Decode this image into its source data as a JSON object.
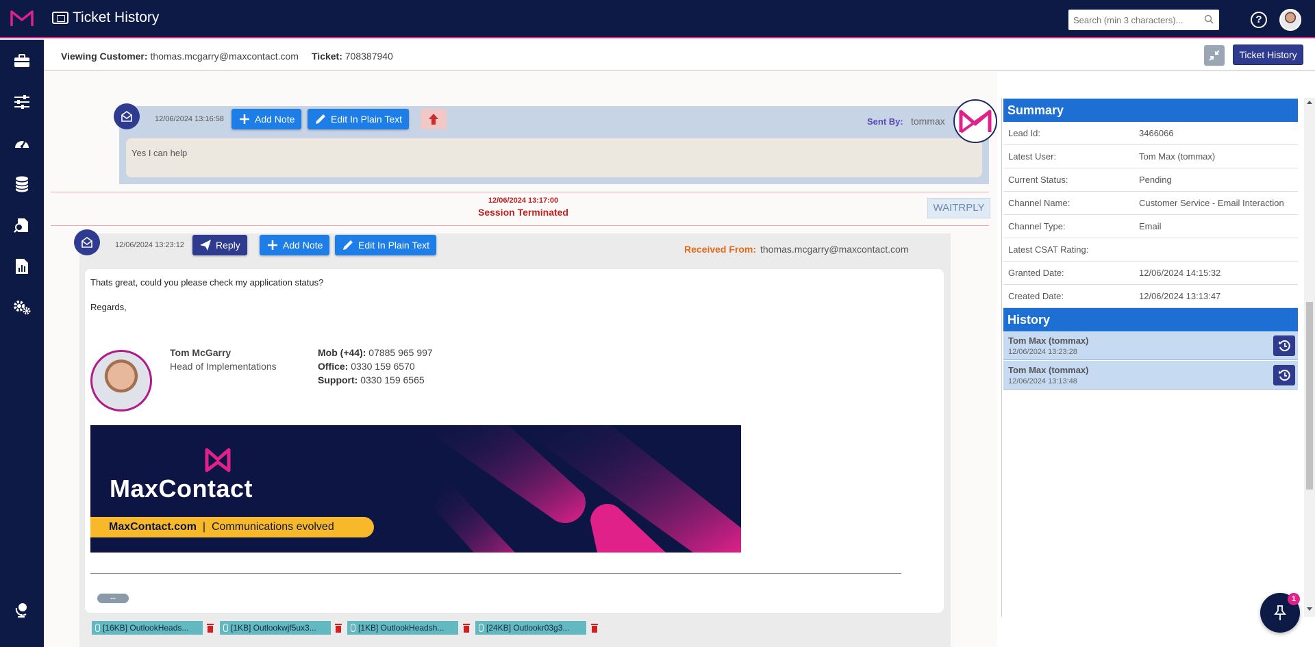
{
  "app": {
    "title": "Ticket History"
  },
  "search": {
    "placeholder": "Search (min 3 characters)..."
  },
  "header": {
    "viewing_customer_label": "Viewing Customer:",
    "viewing_customer_value": "thomas.mcgarry@maxcontact.com",
    "ticket_label": "Ticket:",
    "ticket_value": "708387940",
    "ticket_history_button": "Ticket History"
  },
  "sidebar": {
    "items": [
      {
        "icon": "briefcase-icon"
      },
      {
        "icon": "sliders-icon"
      },
      {
        "icon": "dashboard-gauge-icon"
      },
      {
        "icon": "database-icon"
      },
      {
        "icon": "search-file-icon"
      },
      {
        "icon": "report-chart-icon"
      },
      {
        "icon": "gears-icon"
      },
      {
        "icon": "user-globe-icon"
      }
    ]
  },
  "messages": {
    "sent": {
      "timestamp": "12/06/2024 13:16:58",
      "add_note": "Add Note",
      "edit_plain": "Edit In Plain Text",
      "sent_by_label": "Sent By:",
      "sent_by_value": "tommax",
      "body": "Yes I can help"
    },
    "session": {
      "timestamp": "12/06/2024 13:17:00",
      "label": "Session Terminated",
      "status": "WAITRPLY"
    },
    "received": {
      "timestamp": "12/06/2024 13:23:12",
      "reply": "Reply",
      "add_note": "Add Note",
      "edit_plain": "Edit In Plain Text",
      "received_from_label": "Received From:",
      "received_from_value": "thomas.mcgarry@maxcontact.com",
      "line1": "Thats great, could you please check my application status?",
      "line2": "Regards,",
      "sig_name": "Tom McGarry",
      "sig_title": "Head of Implementations",
      "mob_label": "Mob (+44):",
      "mob_value": "07885 965 997",
      "office_label": "Office:",
      "office_value": "0330 159 6570",
      "support_label": "Support:",
      "support_value": "0330 159 6565",
      "banner_brand": "MaxContact",
      "banner_site": "MaxContact.com",
      "banner_sep": "|",
      "banner_tagline": "Communications evolved",
      "ellipsis": "..."
    },
    "attachments": [
      "[16KB] OutlookHeads...",
      "[1KB] Outlookwjf5ux3...",
      "[1KB] OutlookHeadsh...",
      "[24KB] Outlookr03g3..."
    ]
  },
  "summary": {
    "title": "Summary",
    "rows": [
      {
        "key": "Lead Id:",
        "value": "3466066"
      },
      {
        "key": "Latest User:",
        "value": "Tom Max (tommax)"
      },
      {
        "key": "Current Status:",
        "value": "Pending"
      },
      {
        "key": "Channel Name:",
        "value": "Customer Service - Email Interaction"
      },
      {
        "key": "Channel Type:",
        "value": "Email"
      },
      {
        "key": "Latest CSAT Rating:",
        "value": ""
      },
      {
        "key": "Granted Date:",
        "value": "12/06/2024 14:15:32"
      },
      {
        "key": "Created Date:",
        "value": "12/06/2024 13:13:47"
      }
    ]
  },
  "history": {
    "title": "History",
    "rows": [
      {
        "user": "Tom Max (tommax)",
        "time": "12/06/2024 13:23:28"
      },
      {
        "user": "Tom Max (tommax)",
        "time": "12/06/2024 13:13:48"
      }
    ]
  },
  "notifications": {
    "badge_count": "1"
  },
  "colors": {
    "nav": "#0d1a45",
    "accent": "#e0218a",
    "primary_button": "#1e7ee8",
    "panel_header": "#1e6fd3",
    "session_red": "#c02020"
  }
}
